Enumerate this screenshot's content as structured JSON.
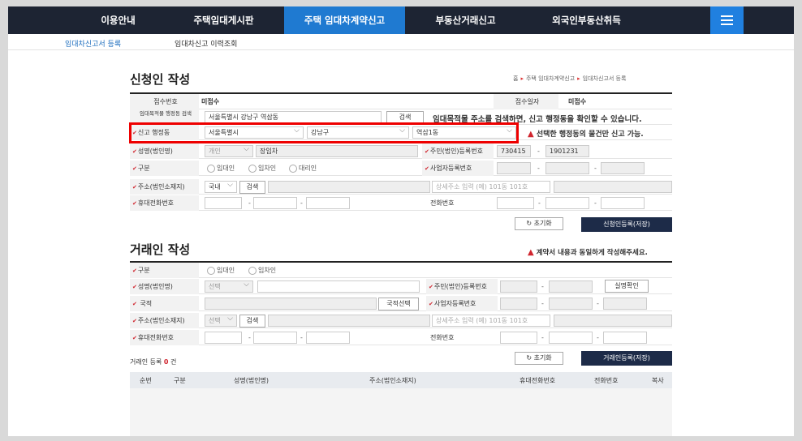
{
  "nav": {
    "items": [
      "이용안내",
      "주택임대게시판",
      "주택 임대차계약신고",
      "부동산거래신고",
      "외국인부동산취득"
    ],
    "active_index": 2
  },
  "subnav": {
    "items": [
      "임대차신고서 등록",
      "임대차신고 이력조회"
    ]
  },
  "applicant": {
    "title": "신청인 작성",
    "breadcrumb": [
      "홈",
      "주택 임대차계약신고",
      "임대차신고서 등록"
    ],
    "receipt_no_label": "접수번호",
    "receipt_no_value": "미접수",
    "receipt_date_label": "접수일자",
    "receipt_date_value": "미접수",
    "lease_addr_label": "임대목적물 행정동 검색",
    "lease_addr_value": "서울특별시 강남구 역삼동",
    "search_btn": "검색",
    "lease_addr_note": "임대목적물 주소를 검색하면, 신고 행정동을 확인할 수 있습니다.",
    "admin_label": "신고 행정동",
    "sido": "서울특별시",
    "sigungu": "강남구",
    "dong": "역삼1동",
    "admin_note": "선택한 행정동의 물건만 신고 가능.",
    "name_label": "성명(법인명)",
    "name_type": "개인",
    "name_value": "장임차",
    "rrn_label": "주민(법인)등록번호",
    "rrn1": "730415",
    "rrn2": "1901231",
    "type_label": "구분",
    "type_options": [
      "임대인",
      "임차인",
      "대리인"
    ],
    "bizno_label": "사업자등록번호",
    "addr_label": "주소(법인소재지)",
    "addr_country": "국내",
    "addr_search": "검색",
    "addr_detail_placeholder": "상세주소 입력 (예) 101동 101호",
    "mobile_label": "휴대전화번호",
    "phone_label": "전화번호",
    "reset_btn": "초기화",
    "save_btn": "신청인등록(저장)"
  },
  "counterparty": {
    "title": "거래인 작성",
    "note": "계약서 내용과 동일하게 작성해주세요.",
    "type_label": "구분",
    "type_options": [
      "임대인",
      "임차인"
    ],
    "name_label": "성명(법인명)",
    "name_type": "선택",
    "rrn_label": "주민(법인)등록번호",
    "verify_btn": "실명확인",
    "nation_label": "국적",
    "nation_btn": "국적선택",
    "bizno_label": "사업자등록번호",
    "addr_label": "주소(법인소재지)",
    "addr_country": "선택",
    "addr_search": "검색",
    "addr_detail_placeholder": "상세주소 입력 (예) 101동 101호",
    "mobile_label": "휴대전화번호",
    "phone_label": "전화번호",
    "count_label": "거래인 등록",
    "count_value": "0",
    "count_unit": "건",
    "reset_btn": "초기화",
    "save_btn": "거래인등록(저장)"
  },
  "table": {
    "headers": [
      "순번",
      "구분",
      "성명(법인명)",
      "주소(법인소재지)",
      "휴대전화번호",
      "전화번호",
      "복사"
    ]
  }
}
